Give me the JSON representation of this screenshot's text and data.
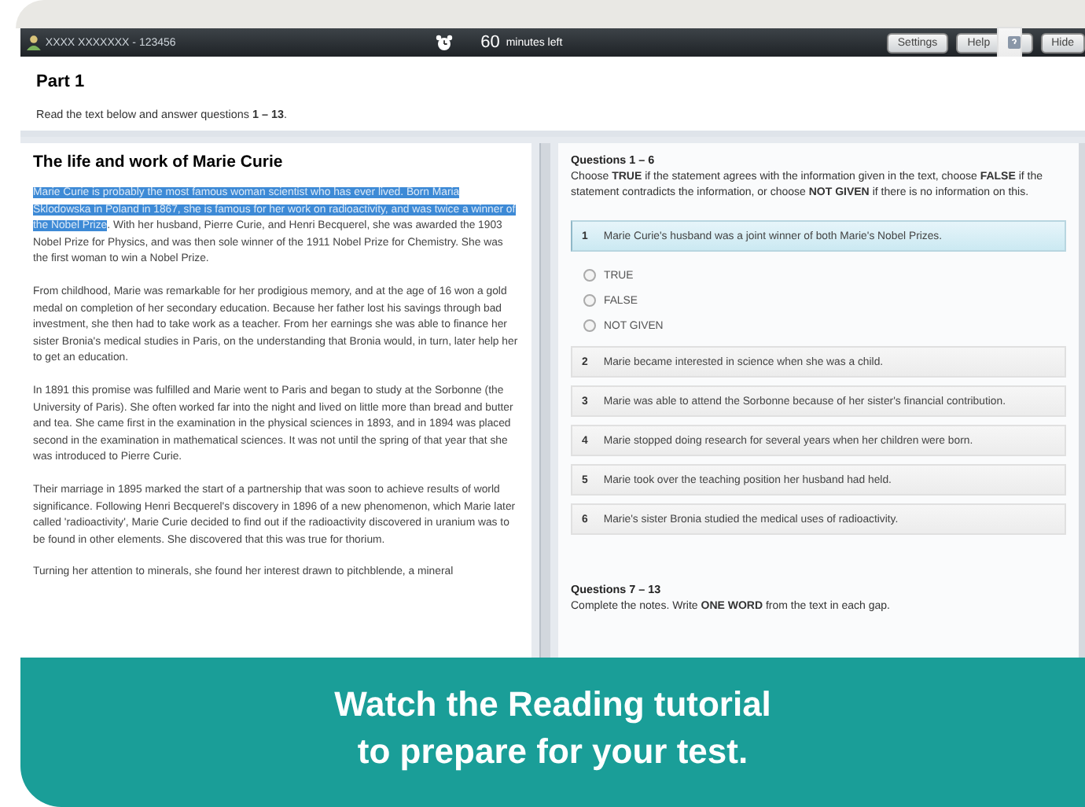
{
  "top_bar": {
    "candidate": "XXXX XXXXXXX - 123456",
    "timer_value": "60",
    "timer_label": "minutes left",
    "buttons": [
      {
        "label": "Settings",
        "kind": "plain"
      },
      {
        "label": "Help",
        "kind": "help"
      },
      {
        "label": "Hide",
        "kind": "plain"
      }
    ]
  },
  "part": {
    "title": "Part 1",
    "instruction": "Read the text below and answer questions **1 – 13**."
  },
  "passage": {
    "title": "The life and work of Marie Curie",
    "paragraphs": [
      {
        "highlight": "Marie Curie is probably the most famous woman scientist who has ever lived. Born Maria Sklodowska in Poland in 1867, she is famous for her work on radioactivity, and was twice a winner of the Nobel Prize",
        "text": ". With her husband, Pierre Curie, and Henri Becquerel, she was awarded the 1903 Nobel Prize for Physics, and was then sole winner of the 1911 Nobel Prize for Chemistry. She was the first woman to win a Nobel Prize."
      },
      {
        "text": "From childhood, Marie was remarkable for her prodigious memory, and at the age of 16 won a gold medal on completion of her secondary education. Because her father lost his savings through bad investment, she then had to take work as a teacher. From her earnings she was able to finance her sister Bronia's medical studies in Paris, on the understanding that Bronia would, in turn, later help her to get an education."
      },
      {
        "text": "In 1891 this promise was fulfilled and Marie went to Paris and began to study at the Sorbonne (the University of Paris). She often worked far into the night and lived on little more than bread and butter and tea. She came first in the examination in the physical sciences in 1893, and in 1894 was placed second in the examination in mathematical sciences. It was not until the spring of that year that she was introduced to Pierre Curie."
      },
      {
        "text": "Their marriage in 1895 marked the start of a partnership that was soon to achieve results of world significance. Following Henri Becquerel's discovery in 1896 of a new phenomenon, which Marie later called 'radioactivity', Marie Curie decided to find out if the radioactivity discovered in uranium was to be found in other elements. She discovered that this was true for thorium."
      },
      {
        "text": "Turning her attention to minerals, she found her interest drawn to pitchblende, a mineral"
      }
    ]
  },
  "questions": {
    "title": "Questions 1 – 6",
    "instruction": "Choose **TRUE** if the statement agrees with the information given in the text, choose **FALSE** if the statement contradicts the information, or choose **NOT GIVEN** if there is no information on this.",
    "items": [
      {
        "number": "1",
        "text": "Marie Curie's husband was a joint winner of both Marie's Nobel Prizes.",
        "selected": true,
        "options": [
          {
            "label": "TRUE",
            "checked": false
          },
          {
            "label": "FALSE",
            "checked": false
          },
          {
            "label": "NOT GIVEN",
            "checked": false
          }
        ]
      },
      {
        "number": "2",
        "text": "Marie became interested in science when she was a child.",
        "selected": false
      },
      {
        "number": "3",
        "text": "Marie was able to attend the Sorbonne because of her sister's financial contribution.",
        "selected": false
      },
      {
        "number": "4",
        "text": "Marie stopped doing research for several years when her children were born.",
        "selected": false
      },
      {
        "number": "5",
        "text": "Marie took over the teaching position her husband had held.",
        "selected": false
      },
      {
        "number": "6",
        "text": "Marie's sister Bronia studied the medical uses of radioactivity.",
        "selected": false
      }
    ]
  },
  "questions_2": {
    "title": "Questions 7 – 13",
    "instruction": "Complete the notes. Write **ONE WORD** from the text in each gap."
  },
  "banner": {
    "lines": [
      "Watch the Reading tutorial",
      "to prepare for your test."
    ]
  }
}
